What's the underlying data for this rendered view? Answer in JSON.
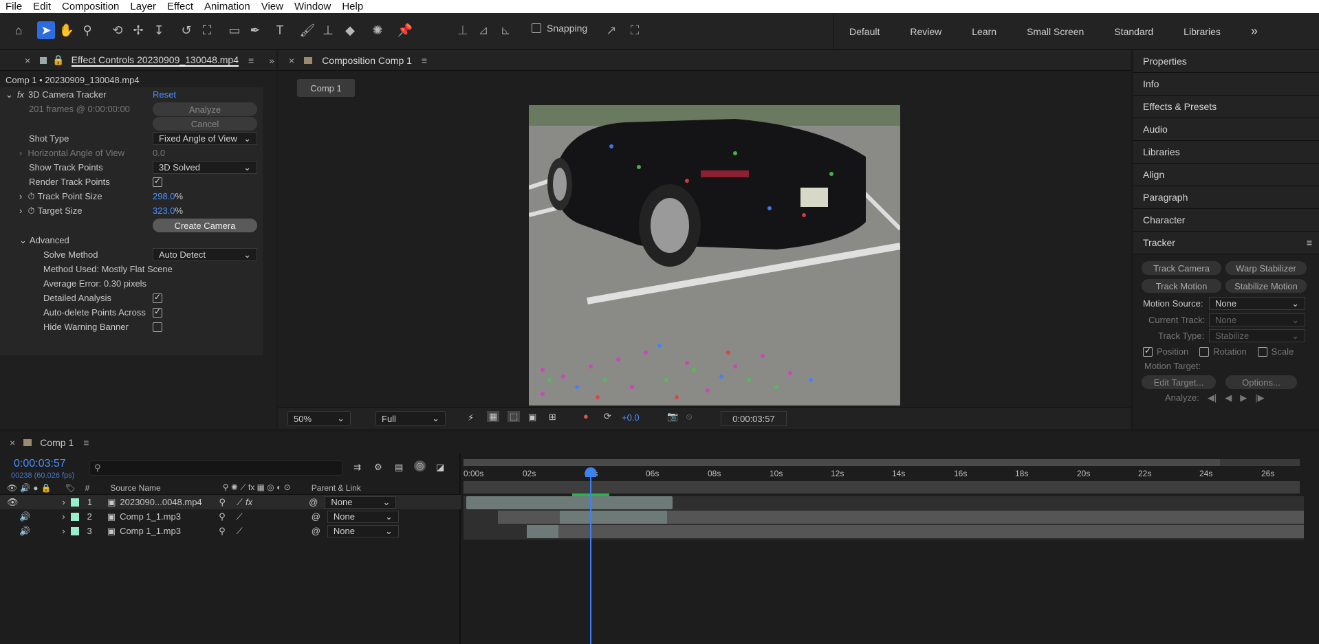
{
  "menu": [
    "File",
    "Edit",
    "Composition",
    "Layer",
    "Effect",
    "Animation",
    "View",
    "Window",
    "Help"
  ],
  "toolbar": {
    "snapping_label": "Snapping",
    "workspaces": [
      "Default",
      "Review",
      "Learn",
      "Small Screen",
      "Standard",
      "Libraries"
    ]
  },
  "effect_controls": {
    "tab_title": "Effect Controls 20230909_130048.mp4",
    "breadcrumb": "Comp 1 • 20230909_130048.mp4",
    "effect_name": "3D Camera Tracker",
    "reset_label": "Reset",
    "frames_info": "201 frames @ 0:00:00:00",
    "analyze_label": "Analyze",
    "cancel_label": "Cancel",
    "shot_type_label": "Shot Type",
    "shot_type_value": "Fixed Angle of View",
    "horizontal_angle_label": "Horizontal Angle of View",
    "horizontal_angle_value": "0.0",
    "show_track_points_label": "Show Track Points",
    "show_track_points_value": "3D Solved",
    "render_track_points_label": "Render Track Points",
    "track_point_size_label": "Track Point Size",
    "track_point_size_value": "298.0",
    "target_size_label": "Target Size",
    "target_size_value": "323.0",
    "percent": "%",
    "create_camera_label": "Create Camera",
    "advanced_label": "Advanced",
    "solve_method_label": "Solve Method",
    "solve_method_value": "Auto Detect",
    "method_used": "Method Used: Mostly Flat Scene",
    "average_error": "Average Error: 0.30 pixels",
    "detailed_analysis_label": "Detailed Analysis",
    "auto_delete_label": "Auto-delete Points Across",
    "hide_warning_label": "Hide Warning Banner"
  },
  "composition": {
    "tab_title": "Composition Comp 1",
    "comp_tab": "Comp 1",
    "zoom": "50%",
    "resolution": "Full",
    "exposure": "+0.0",
    "timecode": "0:00:03:57"
  },
  "right_panel": {
    "items": [
      "Properties",
      "Info",
      "Effects & Presets",
      "Audio",
      "Libraries",
      "Align",
      "Paragraph",
      "Character"
    ],
    "tracker_title": "Tracker",
    "track_camera": "Track Camera",
    "warp_stabilizer": "Warp Stabilizer",
    "track_motion": "Track Motion",
    "stabilize_motion": "Stabilize Motion",
    "motion_source_label": "Motion Source:",
    "motion_source_value": "None",
    "current_track_label": "Current Track:",
    "current_track_value": "None",
    "track_type_label": "Track Type:",
    "track_type_value": "Stabilize",
    "position_label": "Position",
    "rotation_label": "Rotation",
    "scale_label": "Scale",
    "motion_target_label": "Motion Target:",
    "edit_target": "Edit Target...",
    "options": "Options...",
    "analyze_label": "Analyze:"
  },
  "timeline": {
    "tab_title": "Comp 1",
    "timecode": "0:00:03:57",
    "frame_info": "00238 (60.026 fps)",
    "col_hash": "#",
    "col_source": "Source Name",
    "col_parent": "Parent & Link",
    "ruler": [
      "0:00s",
      "02s",
      "04s",
      "06s",
      "08s",
      "10s",
      "12s",
      "14s",
      "16s",
      "18s",
      "20s",
      "22s",
      "24s",
      "26s"
    ],
    "layers": [
      {
        "num": "1",
        "name": "2023090...0048.mp4",
        "parent": "None"
      },
      {
        "num": "2",
        "name": "Comp 1_1.mp3",
        "parent": "None"
      },
      {
        "num": "3",
        "name": "Comp 1_1.mp3",
        "parent": "None"
      }
    ]
  },
  "colors": {
    "accent": "#2d6cdf",
    "blue_value": "#4a90ff",
    "panel_bg": "#1f1f1f"
  }
}
